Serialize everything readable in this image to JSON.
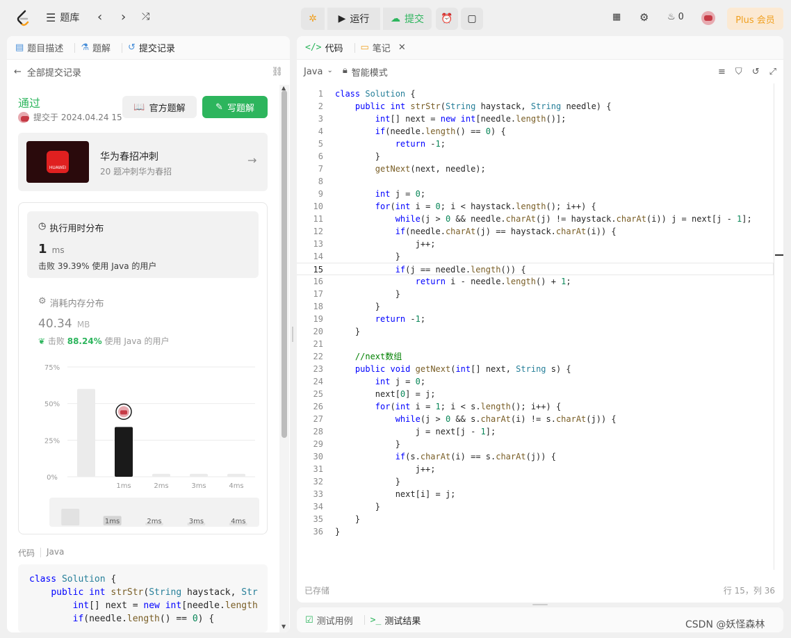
{
  "topbar": {
    "library_label": "题库",
    "run_label": "运行",
    "submit_label": "提交",
    "streak_count": "0",
    "plus_label": "Plus 会员"
  },
  "left": {
    "tabs": [
      {
        "label": "题目描述"
      },
      {
        "label": "题解"
      },
      {
        "label": "提交记录"
      }
    ],
    "back_label": "全部提交记录",
    "status": "通过",
    "submitted_at": "提交于 2024.04.24 15",
    "official_solution": "官方题解",
    "write_solution": "写题解",
    "promo": {
      "title": "华为春招冲刺",
      "subtitle": "20 题冲刺华为春招",
      "brand": "HUAWEI"
    },
    "runtime": {
      "title": "执行用时分布",
      "value": "1",
      "unit": "ms",
      "beat_prefix": "击败 ",
      "beat": "39.39%",
      "beat_suffix": " 使用 Java 的用户"
    },
    "memory": {
      "title": "消耗内存分布",
      "value": "40.34",
      "unit": "MB",
      "beat_prefix": "击败 ",
      "beat": "88.24%",
      "beat_suffix": " 使用 Java 的用户"
    },
    "code_label": "代码",
    "code_lang": "Java",
    "mini_code": [
      "class Solution {",
      "    public int strStr(String haystack, Str",
      "        int[] next = new int[needle.length",
      "        if(needle.length() == 0) {"
    ]
  },
  "chart_data": {
    "type": "bar",
    "categories": [
      "",
      "1ms",
      "2ms",
      "3ms",
      "4ms"
    ],
    "values": [
      60,
      34,
      2,
      2,
      2
    ],
    "ylim": [
      0,
      75
    ],
    "yticks": [
      "75%",
      "50%",
      "25%",
      "0%"
    ],
    "highlight_index": 1,
    "overview_labels": [
      "1ms",
      "2ms",
      "3ms",
      "4ms"
    ]
  },
  "editor": {
    "tabs": [
      {
        "label": "代码"
      },
      {
        "label": "笔记"
      }
    ],
    "language": "Java",
    "mode": "智能模式",
    "saved": "已存储",
    "cursor": "行 15，列 36",
    "lines": [
      "class Solution {",
      "    public int strStr(String haystack, String needle) {",
      "        int[] next = new int[needle.length()];",
      "        if(needle.length() == 0) {",
      "            return -1;",
      "        }",
      "        getNext(next, needle);",
      "",
      "        int j = 0;",
      "        for(int i = 0; i < haystack.length(); i++) {",
      "            while(j > 0 && needle.charAt(j) != haystack.charAt(i)) j = next[j - 1];",
      "            if(needle.charAt(j) == haystack.charAt(i)) {",
      "                j++;",
      "            }",
      "            if(j == needle.length()) {",
      "                return i - needle.length() + 1;",
      "            }",
      "        }",
      "        return -1;",
      "    }",
      "",
      "    //next数组",
      "    public void getNext(int[] next, String s) {",
      "        int j = 0;",
      "        next[0] = j;",
      "        for(int i = 1; i < s.length(); i++) {",
      "            while(j > 0 && s.charAt(i) != s.charAt(j)) {",
      "                j = next[j - 1];",
      "            }",
      "            if(s.charAt(i) == s.charAt(j)) {",
      "                j++;",
      "            }",
      "            next[i] = j;",
      "        }",
      "    }",
      "}"
    ]
  },
  "bottom": {
    "testcase": "测试用例",
    "result": "测试结果"
  },
  "watermark": "CSDN @妖怪森林"
}
